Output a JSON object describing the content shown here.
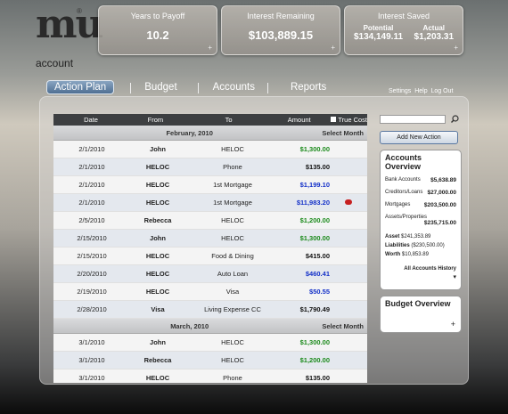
{
  "logo": {
    "mark": "mu",
    "reg": "®",
    "word": "account"
  },
  "stats": {
    "payoff": {
      "title": "Years to Payoff",
      "value": "10.2"
    },
    "remaining": {
      "title": "Interest Remaining",
      "value": "$103,889.15"
    },
    "saved": {
      "title": "Interest Saved",
      "potential_label": "Potential",
      "potential": "$134,149.11",
      "actual_label": "Actual",
      "actual": "$1,203.31"
    },
    "plus": "+"
  },
  "tabs": [
    "Action Plan",
    "Budget",
    "Accounts",
    "Reports"
  ],
  "links": {
    "settings": "Settings",
    "help": "Help",
    "logout": "Log Out"
  },
  "table": {
    "headers": {
      "date": "Date",
      "from": "From",
      "to": "To",
      "amount": "Amount",
      "truecost": "True Cost"
    },
    "months": [
      {
        "name": "February, 2010",
        "action": "Select Month",
        "rows": [
          {
            "date": "2/1/2010",
            "from": "John",
            "to": "HELOC",
            "amount": "$1,300.00",
            "color": "green"
          },
          {
            "date": "2/1/2010",
            "from": "HELOC",
            "to": "Phone",
            "amount": "$135.00",
            "color": "black"
          },
          {
            "date": "2/1/2010",
            "from": "HELOC",
            "to": "1st Mortgage",
            "amount": "$1,199.10",
            "color": "blue"
          },
          {
            "date": "2/1/2010",
            "from": "HELOC",
            "to": "1st Mortgage",
            "amount": "$11,983.20",
            "color": "blue",
            "alert": true
          },
          {
            "date": "2/5/2010",
            "from": "Rebecca",
            "to": "HELOC",
            "amount": "$1,200.00",
            "color": "green"
          },
          {
            "date": "2/15/2010",
            "from": "John",
            "to": "HELOC",
            "amount": "$1,300.00",
            "color": "green"
          },
          {
            "date": "2/15/2010",
            "from": "HELOC",
            "to": "Food & Dining",
            "amount": "$415.00",
            "color": "black"
          },
          {
            "date": "2/20/2010",
            "from": "HELOC",
            "to": "Auto Loan",
            "amount": "$460.41",
            "color": "blue"
          },
          {
            "date": "2/19/2010",
            "from": "HELOC",
            "to": "Visa",
            "amount": "$50.55",
            "color": "blue"
          },
          {
            "date": "2/28/2010",
            "from": "Visa",
            "to": "Living Expense CC",
            "amount": "$1,790.49",
            "color": "black"
          }
        ]
      },
      {
        "name": "March, 2010",
        "action": "Select Month",
        "rows": [
          {
            "date": "3/1/2010",
            "from": "John",
            "to": "HELOC",
            "amount": "$1,300.00",
            "color": "green"
          },
          {
            "date": "3/1/2010",
            "from": "Rebecca",
            "to": "HELOC",
            "amount": "$1,200.00",
            "color": "green"
          },
          {
            "date": "3/1/2010",
            "from": "HELOC",
            "to": "Phone",
            "amount": "$135.00",
            "color": "black"
          }
        ]
      }
    ]
  },
  "sidebar": {
    "add_action": "Add New Action",
    "accounts_overview": {
      "title": "Accounts Overview",
      "items": [
        {
          "label": "Bank Accounts",
          "value": "$5,638.89"
        },
        {
          "label": "Creditors/Loans",
          "value": "$27,000.00"
        },
        {
          "label": "Mortgages",
          "value": "$203,500.00"
        },
        {
          "label": "Assets/Properties",
          "value": "$235,715.00"
        }
      ],
      "asset_label": "Asset",
      "asset": "$241,353.89",
      "liabilities_label": "Liabilities",
      "liabilities": "($230,500.00)",
      "worth_label": "Worth",
      "worth": "$10,853.89",
      "history": "All Accounts History"
    },
    "budget_overview": {
      "title": "Budget Overview"
    }
  }
}
